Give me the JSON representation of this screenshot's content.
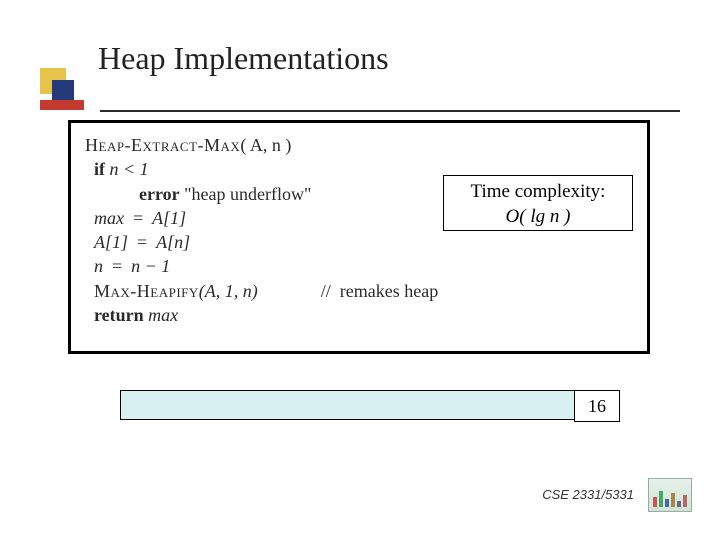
{
  "title": "Heap Implementations",
  "algo": {
    "name_a": "Heap-Extract-Max",
    "args": "( A, n )",
    "l1_kw": "if",
    "l1_cond": "n < 1",
    "l2_kw": "error",
    "l2_msg": " \"heap underflow\"",
    "l3_lhs": "max",
    "l3_rhs": "A[1]",
    "l4_lhs": "A[1]",
    "l4_rhs": "A[n]",
    "l5_lhs": "n",
    "l5_rhs": "n − 1",
    "l6_call": "Max-Heapify",
    "l6_args": "(A, 1, n)",
    "l6_comment": "//  remakes heap",
    "l7_kw": "return",
    "l7_val": " max"
  },
  "complexity": {
    "label": "Time complexity:",
    "value": "O( lg n )"
  },
  "bottom_value": "16",
  "footer": "CSE 2331/5331"
}
